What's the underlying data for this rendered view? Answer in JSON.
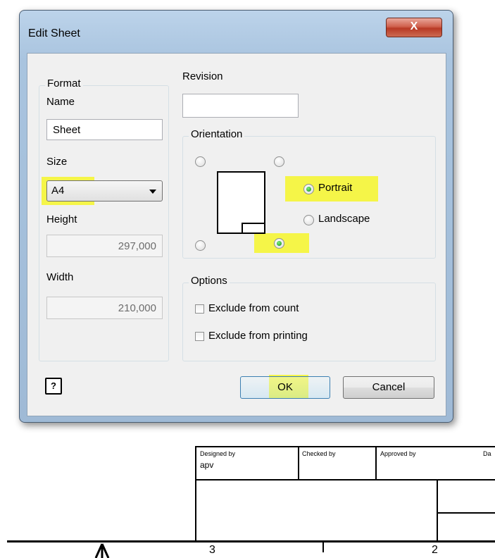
{
  "dialog": {
    "title": "Edit Sheet",
    "close_glyph": "X",
    "format": {
      "legend": "Format",
      "name_label": "Name",
      "name_value": "Sheet",
      "size_label": "Size",
      "size_value": "A4",
      "height_label": "Height",
      "height_value": "297,000",
      "width_label": "Width",
      "width_value": "210,000"
    },
    "revision": {
      "label": "Revision",
      "value": ""
    },
    "orientation": {
      "legend": "Orientation",
      "portrait_label": "Portrait",
      "landscape_label": "Landscape",
      "selected": "Portrait"
    },
    "options": {
      "legend": "Options",
      "exclude_count_label": "Exclude from count",
      "exclude_printing_label": "Exclude from printing"
    },
    "help_glyph": "?",
    "ok_label": "OK",
    "cancel_label": "Cancel"
  },
  "title_block": {
    "designed_by_label": "Designed by",
    "designed_by_value": "apv",
    "checked_by_label": "Checked by",
    "approved_by_label": "Approved by",
    "date_label_partial": "Da",
    "zone_3": "3",
    "zone_2": "2"
  },
  "colors": {
    "highlight": "#f5f535",
    "radio_checked": "#22aa22"
  }
}
